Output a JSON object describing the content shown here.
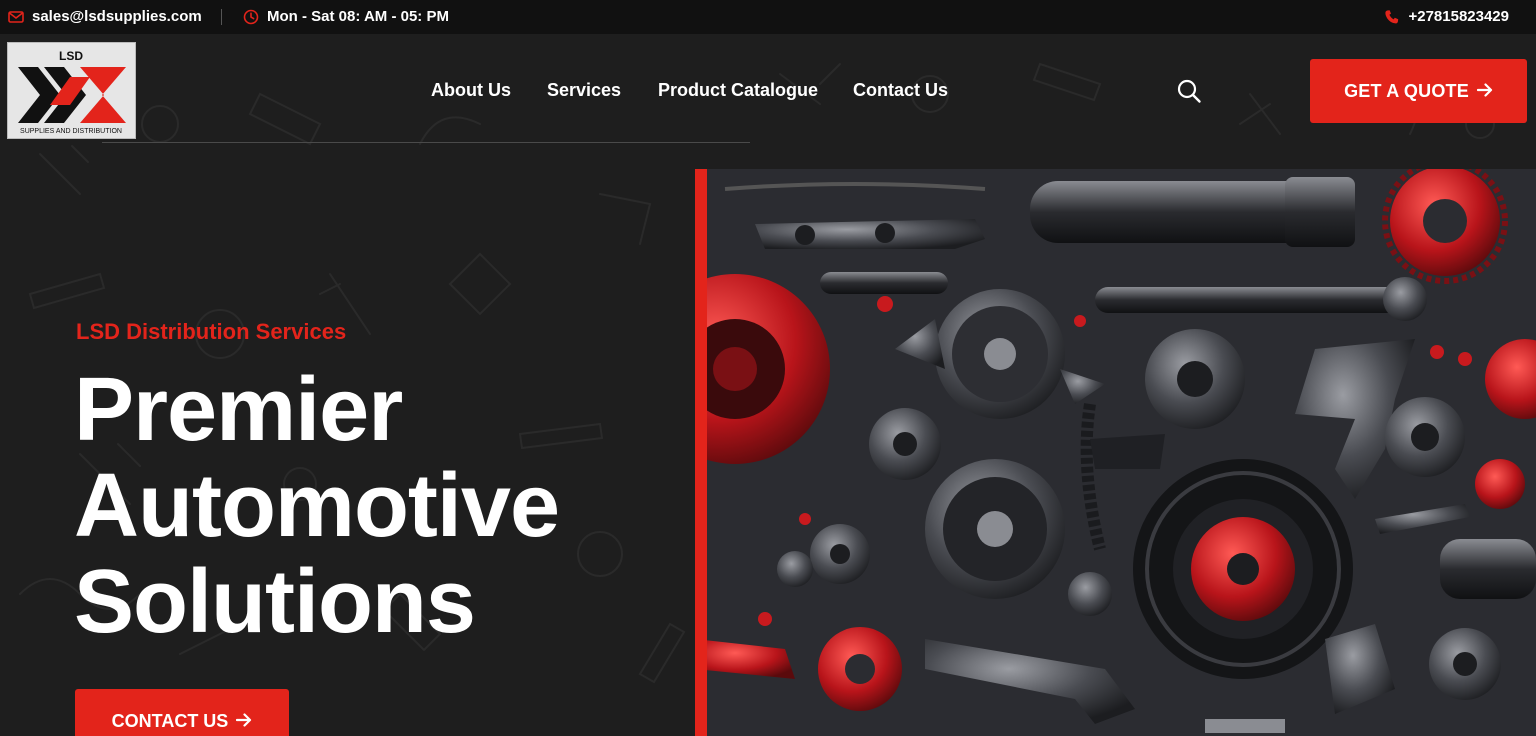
{
  "topbar": {
    "email": "sales@lsdsupplies.com",
    "hours": "Mon - Sat 08: AM - 05: PM",
    "phone": "+27815823429"
  },
  "logo": {
    "top_text": "LSD",
    "bottom_text": "SUPPLIES AND DISTRIBUTION"
  },
  "nav": {
    "items": [
      {
        "label": "About Us"
      },
      {
        "label": "Services"
      },
      {
        "label": "Product Catalogue"
      },
      {
        "label": "Contact Us"
      }
    ]
  },
  "header": {
    "quote_label": "GET A QUOTE"
  },
  "hero": {
    "eyebrow": "LSD Distribution Services",
    "headline_lines": [
      "Premier",
      "Automotive",
      "Solutions"
    ],
    "cta_label": "CONTACT US"
  },
  "colors": {
    "accent": "#e3241b",
    "background": "#1e1e1e",
    "topbar": "#111111"
  },
  "icons": {
    "email": "envelope-icon",
    "hours": "clock-icon",
    "phone": "phone-icon",
    "search": "search-icon",
    "arrow": "arrow-right-icon"
  }
}
